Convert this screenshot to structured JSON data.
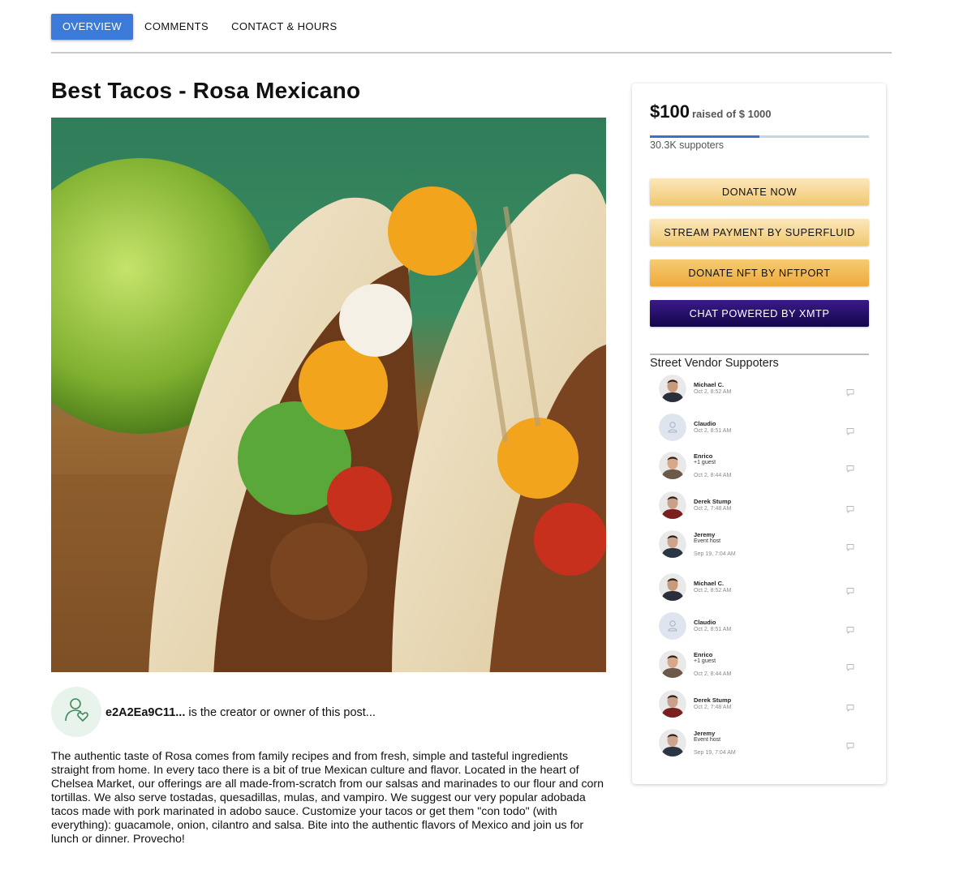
{
  "tabs": [
    {
      "label": "OVERVIEW",
      "active": true
    },
    {
      "label": "COMMENTS",
      "active": false
    },
    {
      "label": "CONTACT & HOURS",
      "active": false
    }
  ],
  "post": {
    "title": "Best Tacos - Rosa Mexicano",
    "image_alt": "tacos-photo",
    "owner_address": "e2A2Ea9C11...",
    "owner_suffix": " is the creator or owner of this post...",
    "description": "The authentic taste of Rosa comes from family recipes and from fresh, simple and tasteful ingredients straight from home. In every taco there is a bit of true Mexican culture and flavor. Located in the heart of Chelsea Market, our offerings are all made-from-scratch from our salsas and marinades to our flour and corn tortillas. We also serve tostadas, quesadillas, mulas, and vampiro. We suggest our very popular adobada tacos made with pork marinated in adobo sauce. Customize your tacos or get them \"con todo\" (with everything): guacamole, onion, cilantro and salsa. Bite into the authentic flavors of Mexico and join us for lunch or dinner. Provecho!"
  },
  "funding": {
    "raised": "$100",
    "raised_suffix": "raised of $ 1000",
    "progress_fraction": 0.5,
    "supporters_count": "30.3K suppoters"
  },
  "actions": {
    "donate": "DONATE NOW",
    "stream": "STREAM PAYMENT BY SUPERFLUID",
    "nft": "DONATE NFT BY NFTPORT",
    "chat": "CHAT POWERED BY XMTP"
  },
  "supporters": {
    "title": "Street Vendor Suppoters",
    "items": [
      {
        "name": "Michael C.",
        "extra": "",
        "time": "Oct 2, 8:52 AM",
        "avatar": "photo-1"
      },
      {
        "name": "Claudio",
        "extra": "",
        "time": "Oct 2, 8:51 AM",
        "avatar": "placeholder"
      },
      {
        "name": "Enrico",
        "extra": "+1 guest",
        "time": "Oct 2, 8:44 AM",
        "avatar": "photo-2"
      },
      {
        "name": "Derek Stump",
        "extra": "",
        "time": "Oct 2, 7:48 AM",
        "avatar": "photo-3"
      },
      {
        "name": "Jeremy",
        "extra": "Event host",
        "time": "Sep 19, 7:04 AM",
        "avatar": "photo-4"
      },
      {
        "name": "Michael C.",
        "extra": "",
        "time": "Oct 2, 8:52 AM",
        "avatar": "photo-1"
      },
      {
        "name": "Claudio",
        "extra": "",
        "time": "Oct 2, 8:51 AM",
        "avatar": "placeholder"
      },
      {
        "name": "Enrico",
        "extra": "+1 guest",
        "time": "Oct 2, 8:44 AM",
        "avatar": "photo-2"
      },
      {
        "name": "Derek Stump",
        "extra": "",
        "time": "Oct 2, 7:48 AM",
        "avatar": "photo-3"
      },
      {
        "name": "Jeremy",
        "extra": "Event host",
        "time": "Sep 19, 7:04 AM",
        "avatar": "photo-4"
      }
    ]
  },
  "colors": {
    "tab_active": "#3b7ad9",
    "donate_button": "#f1c870",
    "nft_button": "#eea93b",
    "chat_button": "#14064a",
    "progress_fill": "#3b6fd0",
    "owner_icon": "#3e8a5a"
  },
  "icons": {
    "owner": "user-heart-icon",
    "supporter_action": "chat-bubble-icon"
  }
}
